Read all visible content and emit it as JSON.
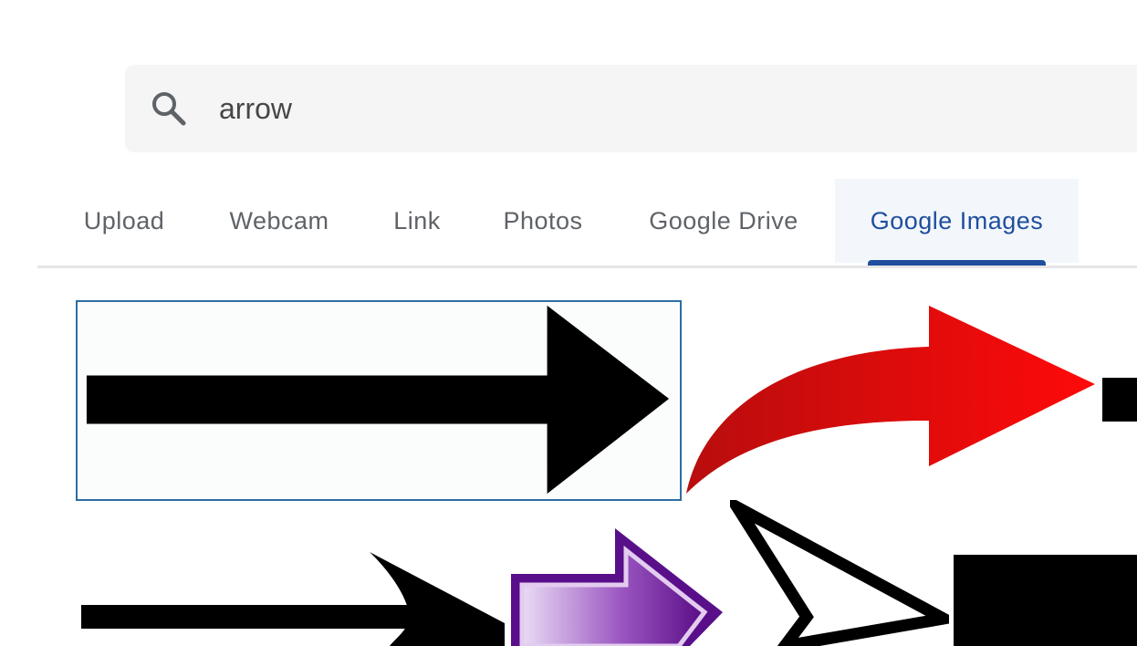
{
  "search": {
    "query": "arrow",
    "icon": "search-icon"
  },
  "tabs": [
    {
      "label": "Upload",
      "active": false
    },
    {
      "label": "Webcam",
      "active": false
    },
    {
      "label": "Link",
      "active": false
    },
    {
      "label": "Photos",
      "active": false
    },
    {
      "label": "Google Drive",
      "active": false
    },
    {
      "label": "Google Images",
      "active": true
    }
  ],
  "results": [
    {
      "name": "black-straight-arrow",
      "selected": true
    },
    {
      "name": "red-curved-arrow",
      "selected": false
    },
    {
      "name": "black-block-arrow",
      "selected": false
    },
    {
      "name": "thin-black-arrow",
      "selected": false
    },
    {
      "name": "purple-gradient-arrow",
      "selected": false
    },
    {
      "name": "outlined-chevron-arrow",
      "selected": false
    },
    {
      "name": "black-square-arrow",
      "selected": false
    }
  ],
  "colors": {
    "accent": "#1f4e9e",
    "selection_border": "#2e6da4",
    "search_bg": "#f5f5f5",
    "tab_text": "#5f6368",
    "active_tab_bg": "#f3f7fb"
  }
}
